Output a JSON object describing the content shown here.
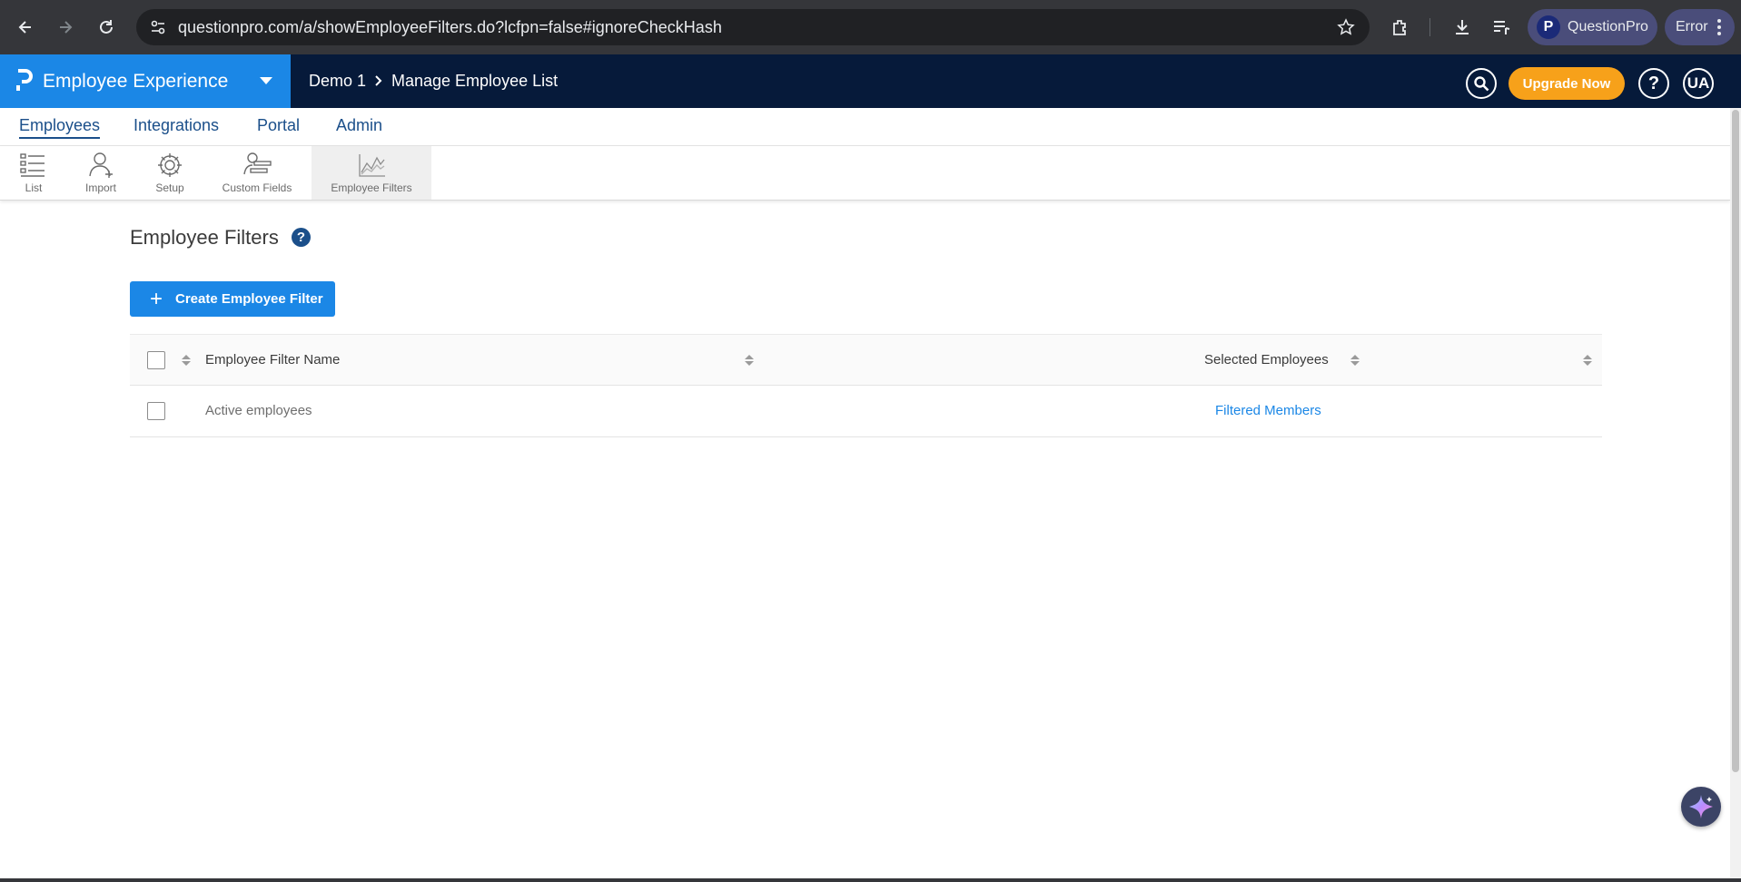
{
  "browser": {
    "url": "questionpro.com/a/showEmployeeFilters.do?lcfpn=false#ignoreCheckHash",
    "profile_name": "QuestionPro",
    "profile_initial": "P",
    "error_label": "Error"
  },
  "app": {
    "brand_title": "Employee Experience",
    "breadcrumb": [
      "Demo 1",
      "Manage Employee List"
    ],
    "upgrade_label": "Upgrade Now",
    "help_symbol": "?",
    "user_initials": "UA"
  },
  "primary_nav": [
    {
      "label": "Employees",
      "active": true
    },
    {
      "label": "Integrations",
      "active": false
    },
    {
      "label": "Portal",
      "active": false
    },
    {
      "label": "Admin",
      "active": false
    }
  ],
  "sub_nav": [
    {
      "label": "List",
      "icon": "list-icon"
    },
    {
      "label": "Import",
      "icon": "user-add-icon"
    },
    {
      "label": "Setup",
      "icon": "gear-icon"
    },
    {
      "label": "Custom Fields",
      "icon": "custom-fields-icon"
    },
    {
      "label": "Employee Filters",
      "icon": "chart-icon",
      "active": true
    }
  ],
  "page": {
    "title": "Employee Filters",
    "help_symbol": "?",
    "create_button": {
      "plus": "+",
      "label": "Create Employee Filter"
    }
  },
  "table": {
    "columns": [
      "Employee Filter Name",
      "Selected Employees"
    ],
    "rows": [
      {
        "name": "Active employees",
        "selected": "Filtered Members"
      }
    ]
  },
  "colors": {
    "brand_blue": "#1b87e6",
    "header_navy": "#061a3a",
    "upgrade_orange": "#f7a11a",
    "link_blue": "#1b87e6"
  }
}
